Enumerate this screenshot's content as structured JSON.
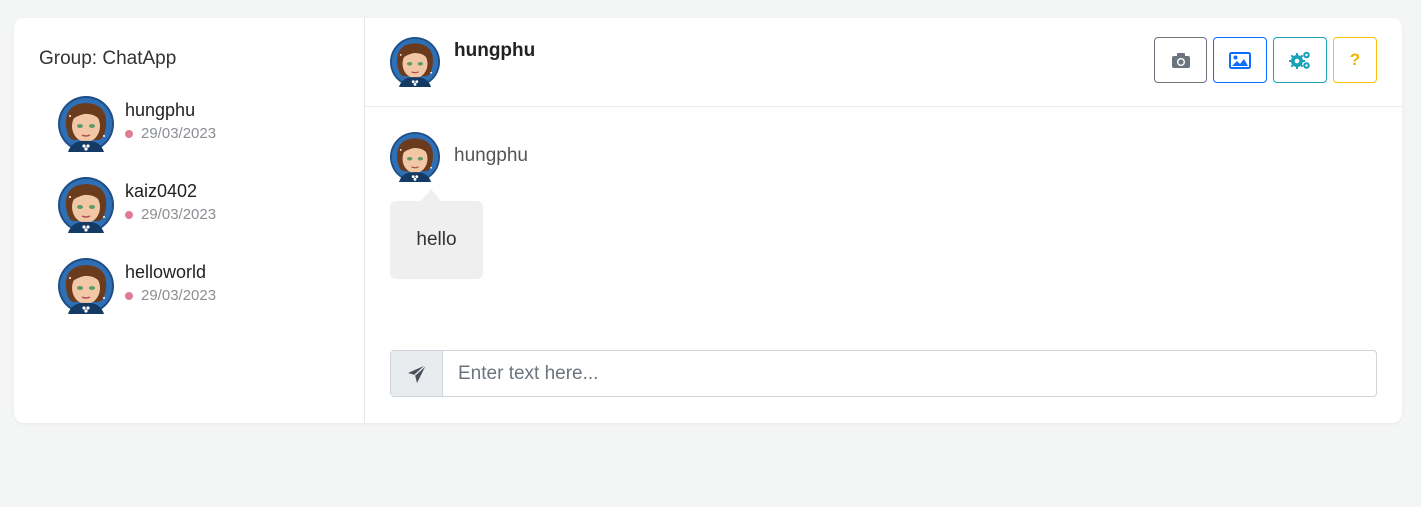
{
  "sidebar": {
    "group_title": "Group: ChatApp",
    "users": [
      {
        "name": "hungphu",
        "date": "29/03/2023"
      },
      {
        "name": "kaiz0402",
        "date": "29/03/2023"
      },
      {
        "name": "helloworld",
        "date": "29/03/2023"
      }
    ]
  },
  "header": {
    "name": "hungphu",
    "buttons": [
      {
        "icon": "camera-icon",
        "color": "#6c757d"
      },
      {
        "icon": "image-icon",
        "color": "#0d6efd"
      },
      {
        "icon": "gears-icon",
        "color": "#17a2b8"
      },
      {
        "icon": "question-icon",
        "label": "?",
        "color": "#ffc107"
      }
    ]
  },
  "messages": [
    {
      "author": "hungphu",
      "text": "hello"
    }
  ],
  "composer": {
    "placeholder": "Enter text here...",
    "send_icon": "paper-plane-icon"
  },
  "colors": {
    "status_dot": "#e07a95",
    "bubble": "#efefef",
    "background": "#f4f5f5"
  }
}
